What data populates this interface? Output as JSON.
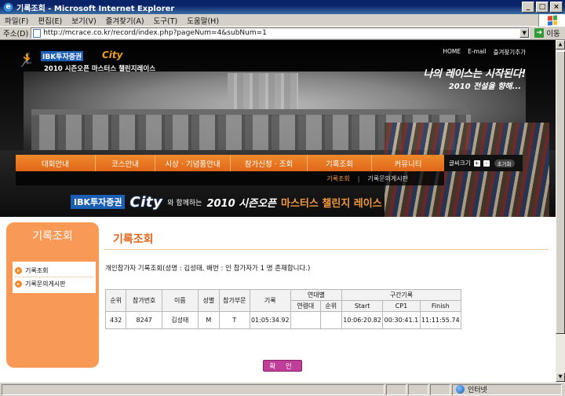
{
  "window": {
    "title": "기록조회 - Microsoft Internet Explorer",
    "controls": [
      "_",
      "□",
      "×"
    ]
  },
  "menu": [
    "파일(F)",
    "편집(E)",
    "보기(V)",
    "즐겨찾기(A)",
    "도구(T)",
    "도움말(H)"
  ],
  "address": {
    "label": "주소(D)",
    "url": "http://mcrace.co.kr/record/index.php?pageNum=4&subNum=1",
    "go_label": "이동"
  },
  "header": {
    "logo_brand": "IBK투자증권",
    "logo_city": "City",
    "logo_event": "2010 시즌오픈 마스터스 챌린지레이스",
    "top_links": [
      "HOME",
      "E-mail",
      "즐겨찾기추가"
    ],
    "slogan_main": "나의 레이스는 시작된다!",
    "slogan_sub": "2010 전설을 향해...",
    "nav": [
      "대회안내",
      "코스안내",
      "시상 · 기념품안내",
      "참가신청 · 조회",
      "기록조회",
      "커뮤니티"
    ],
    "font_size_label": "글씨크기",
    "font_plus": "+",
    "font_minus": "-",
    "font_reset": "초기화",
    "subnav": [
      "기록조회",
      "기록문의게시판"
    ],
    "banner": {
      "ibk": "IBK투자증권",
      "city": "City",
      "with": "와 함께하는",
      "season": "2010 시즌오픈",
      "race": "마스터스 챌린지 레이스"
    }
  },
  "sidebar": {
    "title": "기록조회",
    "items": [
      "기록조회",
      "기록문의게시판"
    ]
  },
  "content": {
    "title": "기록조회",
    "info": "개인참가자 기록조회(성명 : 김성태, 배번 : 인 참가자가 1 명 존재합니다.)",
    "table": {
      "headers": {
        "rank": "순위",
        "bib": "참가번호",
        "name": "이름",
        "gender": "성별",
        "category": "참가부문",
        "record": "기록",
        "age_group": "연대별",
        "age_group_sub": [
          "연령대",
          "순위"
        ],
        "split": "구간기록",
        "split_sub": [
          "Start",
          "CP1",
          "Finish"
        ]
      },
      "rows": [
        {
          "rank": "432",
          "bib": "8247",
          "name": "김성태",
          "gender": "M",
          "category": "T",
          "record": "01:05:34.92",
          "age_group": "",
          "age_rank": "",
          "start": "10:06:20.82",
          "cp1": "00:30:41.1",
          "finish": "11:11:55.74"
        }
      ]
    },
    "confirm_label": "확 인"
  },
  "status": {
    "zone": "인터넷"
  },
  "colors": {
    "accent": "#f08a2a",
    "title_orange": "#e0661a",
    "confirm": "#c13d9a"
  }
}
